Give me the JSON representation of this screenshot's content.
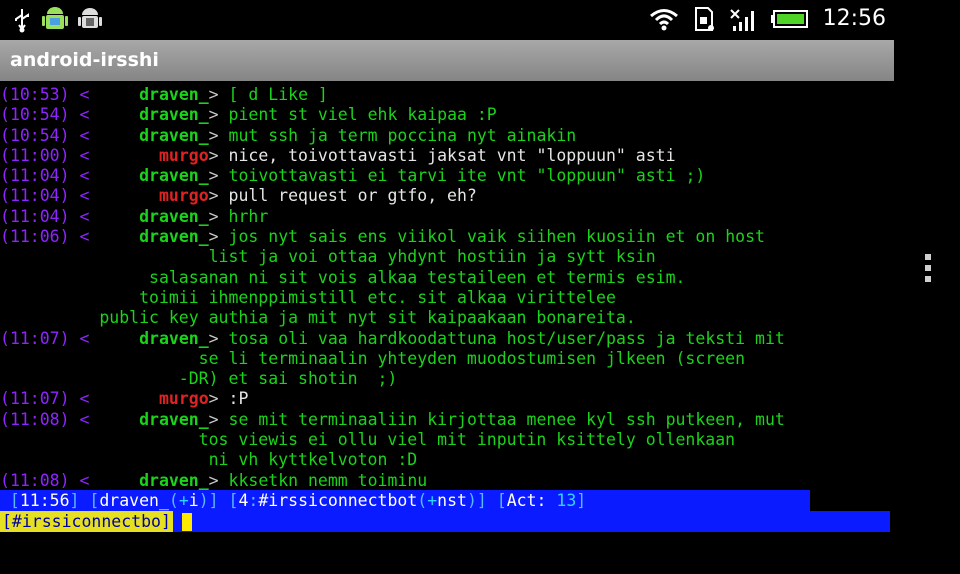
{
  "status_bar": {
    "icons": [
      "usb-icon",
      "android-debug-icon",
      "android-icon",
      "wifi-icon",
      "sd-card-icon",
      "signal-icon",
      "battery-icon"
    ],
    "time": "12:56"
  },
  "app": {
    "title": "android-irsshi"
  },
  "colors": {
    "timestamp": "#8f24ff",
    "nick_self": "#1bd31b",
    "nick_other": "#e02222",
    "status_bg": "#0a1bff",
    "prompt_bg": "#e6e022"
  },
  "log": [
    {
      "time": "10:53",
      "nick": "draven_",
      "nick_type": "dra",
      "text": "[ d Like ]",
      "color": "green"
    },
    {
      "time": "10:54",
      "nick": "draven_",
      "nick_type": "dra",
      "text": "pient st viel ehk kaipaa :P",
      "color": "green"
    },
    {
      "time": "10:54",
      "nick": "draven_",
      "nick_type": "dra",
      "text": "mut ssh ja term poccina nyt ainakin",
      "color": "green"
    },
    {
      "time": "11:00",
      "nick": "murgo",
      "nick_type": "mur",
      "text": "nice, toivottavasti jaksat vnt \"loppuun\" asti",
      "color": "white"
    },
    {
      "time": "11:04",
      "nick": "draven_",
      "nick_type": "dra",
      "text": "toivottavasti ei tarvi ite vnt \"loppuun\" asti ;)",
      "color": "green"
    },
    {
      "time": "11:04",
      "nick": "murgo",
      "nick_type": "mur",
      "text": "pull request or gtfo, eh?",
      "color": "white"
    },
    {
      "time": "11:04",
      "nick": "draven_",
      "nick_type": "dra",
      "text": "hrhr",
      "color": "green"
    },
    {
      "time": "11:06",
      "nick": "draven_",
      "nick_type": "dra",
      "text": "jos nyt sais ens viikol vaik siihen kuosiin et on host",
      "color": "green"
    },
    {
      "cont": "                     list ja voi ottaa yhdynt hostiin ja sytt ksin"
    },
    {
      "cont": "               salasanan ni sit vois alkaa testaileen et termis esim."
    },
    {
      "cont": "              toimii ihmenppimistill etc. sit alkaa virittelee"
    },
    {
      "cont": "          public key authia ja mit nyt sit kaipaakaan bonareita."
    },
    {
      "time": "11:07",
      "nick": "draven_",
      "nick_type": "dra",
      "text": "tosa oli vaa hardkoodattuna host/user/pass ja teksti mit",
      "color": "green"
    },
    {
      "cont": "                    se li terminaalin yhteyden muodostumisen jlkeen (screen"
    },
    {
      "cont": "                  -DR) et sai shotin  ;)"
    },
    {
      "time": "11:07",
      "nick": "murgo",
      "nick_type": "mur",
      "text": ":P",
      "color": "white"
    },
    {
      "time": "11:08",
      "nick": "draven_",
      "nick_type": "dra",
      "text": "se mit terminaaliin kirjottaa menee kyl ssh putkeen, mut",
      "color": "green"
    },
    {
      "cont": "                    tos viewis ei ollu viel mit inputin ksittely ollenkaan"
    },
    {
      "cont": "                     ni vh kyttkelvoton :D"
    },
    {
      "time": "11:08",
      "nick": "draven_",
      "nick_type": "dra",
      "text": "kksetkn nemm toiminu",
      "color": "green"
    }
  ],
  "statusline": {
    "time": "11:56",
    "nick": "draven_",
    "mode_sign": "+",
    "mode": "i",
    "window_num": "4",
    "channel": "#irssiconnectbot",
    "channel_mode_sign": "+",
    "channel_mode": "nst",
    "act_label": "Act:",
    "act_value": "13"
  },
  "input": {
    "prompt": "[#irssiconnectbo]"
  }
}
